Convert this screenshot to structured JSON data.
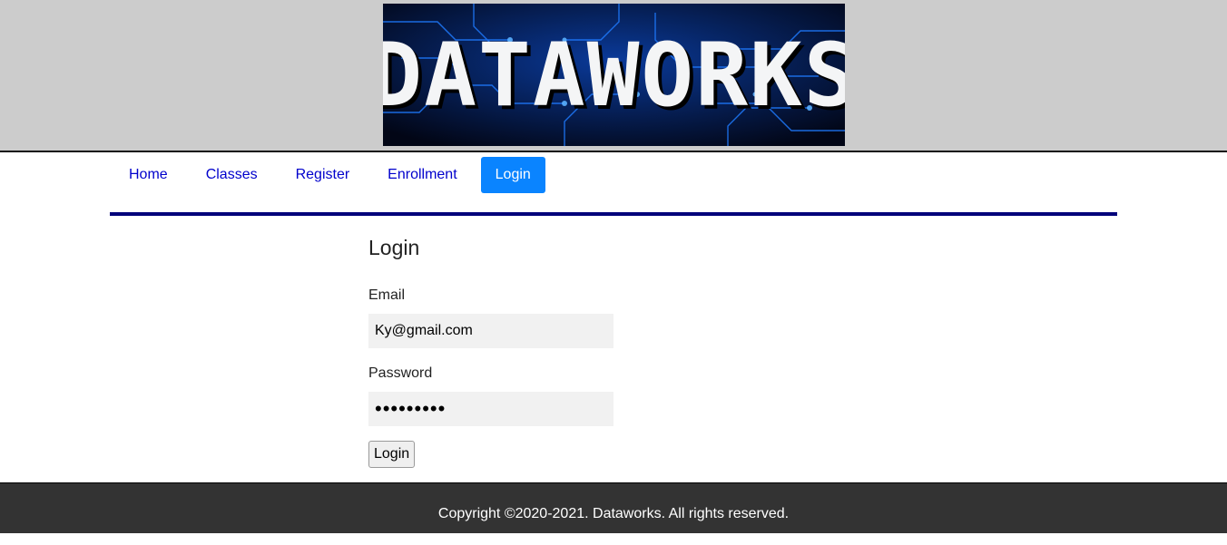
{
  "header": {
    "logo_text": "DATAWORKS"
  },
  "nav": {
    "items": [
      {
        "label": "Home"
      },
      {
        "label": "Classes"
      },
      {
        "label": "Register"
      },
      {
        "label": "Enrollment"
      },
      {
        "label": "Login"
      }
    ],
    "active": "Login"
  },
  "login": {
    "title": "Login",
    "email_label": "Email",
    "email_value": "Ky@gmail.com",
    "password_label": "Password",
    "password_value": "•••••••••",
    "submit_label": "Login"
  },
  "footer": {
    "copyright": "Copyright ©2020-2021. Dataworks. All rights reserved."
  },
  "colors": {
    "header_bg": "#cccccc",
    "nav_link": "#0000cc",
    "nav_active_bg": "#0a84ff",
    "rule": "#00007a",
    "footer_bg": "#333333"
  }
}
